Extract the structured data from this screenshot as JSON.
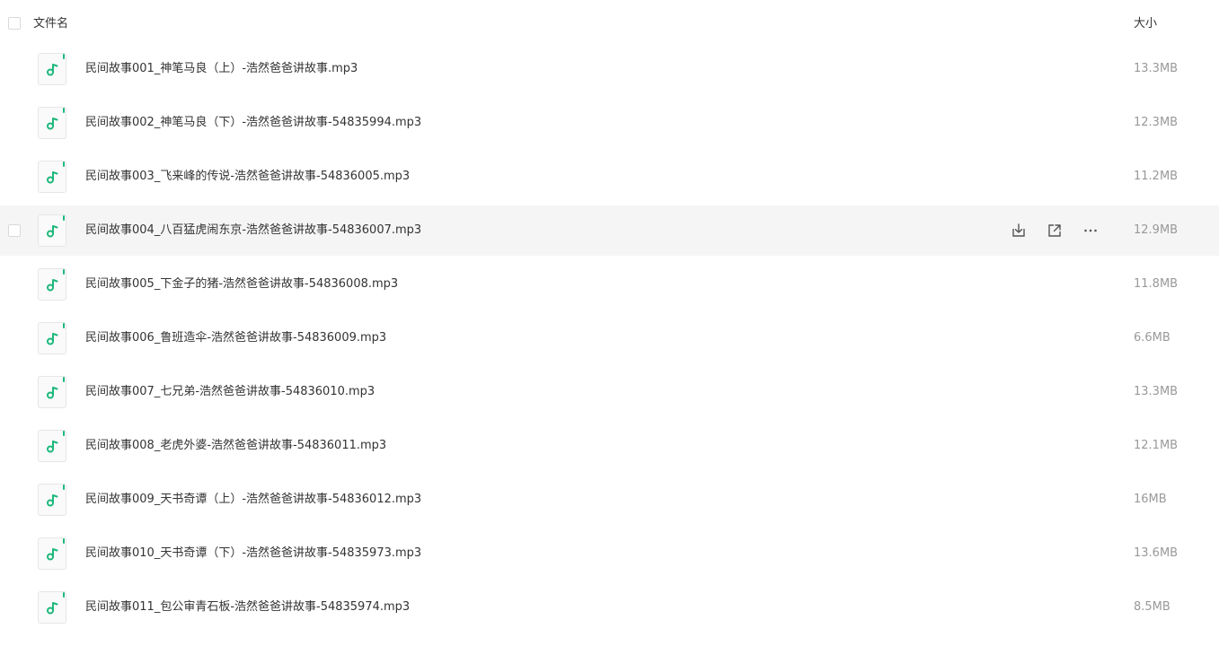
{
  "header": {
    "name_label": "文件名",
    "size_label": "大小"
  },
  "accent_color": "#1db87a",
  "files": [
    {
      "name": "民间故事001_神笔马良（上）-浩然爸爸讲故事.mp3",
      "size": "13.3MB",
      "icon": "music-file-icon"
    },
    {
      "name": "民间故事002_神笔马良（下）-浩然爸爸讲故事-54835994.mp3",
      "size": "12.3MB",
      "icon": "music-file-icon"
    },
    {
      "name": "民间故事003_飞来峰的传说-浩然爸爸讲故事-54836005.mp3",
      "size": "11.2MB",
      "icon": "music-file-icon"
    },
    {
      "name": "民间故事004_八百猛虎闹东京-浩然爸爸讲故事-54836007.mp3",
      "size": "12.9MB",
      "icon": "music-file-icon",
      "hovered": true
    },
    {
      "name": "民间故事005_下金子的猪-浩然爸爸讲故事-54836008.mp3",
      "size": "11.8MB",
      "icon": "music-file-icon"
    },
    {
      "name": "民间故事006_鲁班造伞-浩然爸爸讲故事-54836009.mp3",
      "size": "6.6MB",
      "icon": "music-file-icon"
    },
    {
      "name": "民间故事007_七兄弟-浩然爸爸讲故事-54836010.mp3",
      "size": "13.3MB",
      "icon": "music-file-icon"
    },
    {
      "name": "民间故事008_老虎外婆-浩然爸爸讲故事-54836011.mp3",
      "size": "12.1MB",
      "icon": "music-file-icon"
    },
    {
      "name": "民间故事009_天书奇谭（上）-浩然爸爸讲故事-54836012.mp3",
      "size": "16MB",
      "icon": "music-file-icon"
    },
    {
      "name": "民间故事010_天书奇谭（下）-浩然爸爸讲故事-54835973.mp3",
      "size": "13.6MB",
      "icon": "music-file-icon"
    },
    {
      "name": "民间故事011_包公审青石板-浩然爸爸讲故事-54835974.mp3",
      "size": "8.5MB",
      "icon": "music-file-icon"
    }
  ],
  "row_actions": [
    "download-icon",
    "share-icon",
    "more-icon"
  ]
}
